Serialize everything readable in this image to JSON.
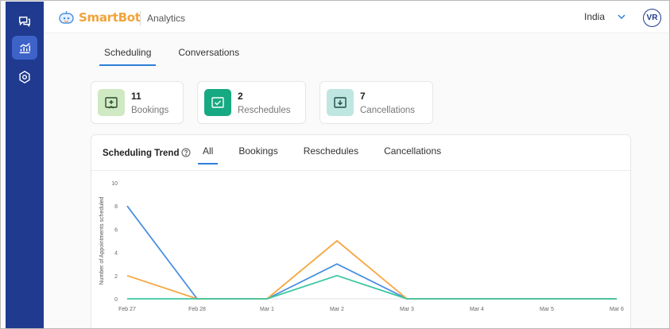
{
  "header": {
    "brand": "SmartBot",
    "app_name": "Analytics",
    "country": "India",
    "avatar_initials": "VR"
  },
  "sidebar": {
    "items": [
      {
        "icon": "chat-icon",
        "active": false
      },
      {
        "icon": "analytics-icon",
        "active": true
      },
      {
        "icon": "settings-icon",
        "active": false
      }
    ]
  },
  "main_tabs": [
    {
      "label": "Scheduling",
      "active": true
    },
    {
      "label": "Conversations",
      "active": false
    }
  ],
  "stats": [
    {
      "value": "11",
      "label": "Bookings",
      "icon": "calendar-plus-icon",
      "color": "#cfeac3"
    },
    {
      "value": "2",
      "label": "Reschedules",
      "icon": "calendar-check-icon",
      "color": "#17a982"
    },
    {
      "value": "7",
      "label": "Cancellations",
      "icon": "calendar-cancel-icon",
      "color": "#bfe6e0"
    }
  ],
  "trend": {
    "title": "Scheduling Trend",
    "tabs": [
      {
        "label": "All",
        "active": true
      },
      {
        "label": "Bookings",
        "active": false
      },
      {
        "label": "Reschedules",
        "active": false
      },
      {
        "label": "Cancellations",
        "active": false
      }
    ]
  },
  "chart_data": {
    "type": "line",
    "ylabel": "Number of Appointments scheduled",
    "xlabel": "",
    "x": [
      "Feb 27",
      "Feb 28",
      "Mar 1",
      "Mar 2",
      "Mar 3",
      "Mar 4",
      "Mar 5",
      "Mar 6"
    ],
    "yticks": [
      0,
      2,
      4,
      6,
      8,
      10
    ],
    "ylim": [
      0,
      10
    ],
    "grid": false,
    "series": [
      {
        "color": "#4a90e2",
        "values": [
          8,
          0,
          0,
          3,
          0,
          0,
          0,
          0
        ]
      },
      {
        "color": "#f5a742",
        "values": [
          2,
          0,
          0,
          5,
          0,
          0,
          0,
          0
        ]
      },
      {
        "color": "#3cc7a0",
        "values": [
          0,
          0,
          0,
          2,
          0,
          0,
          0,
          0
        ]
      }
    ]
  }
}
